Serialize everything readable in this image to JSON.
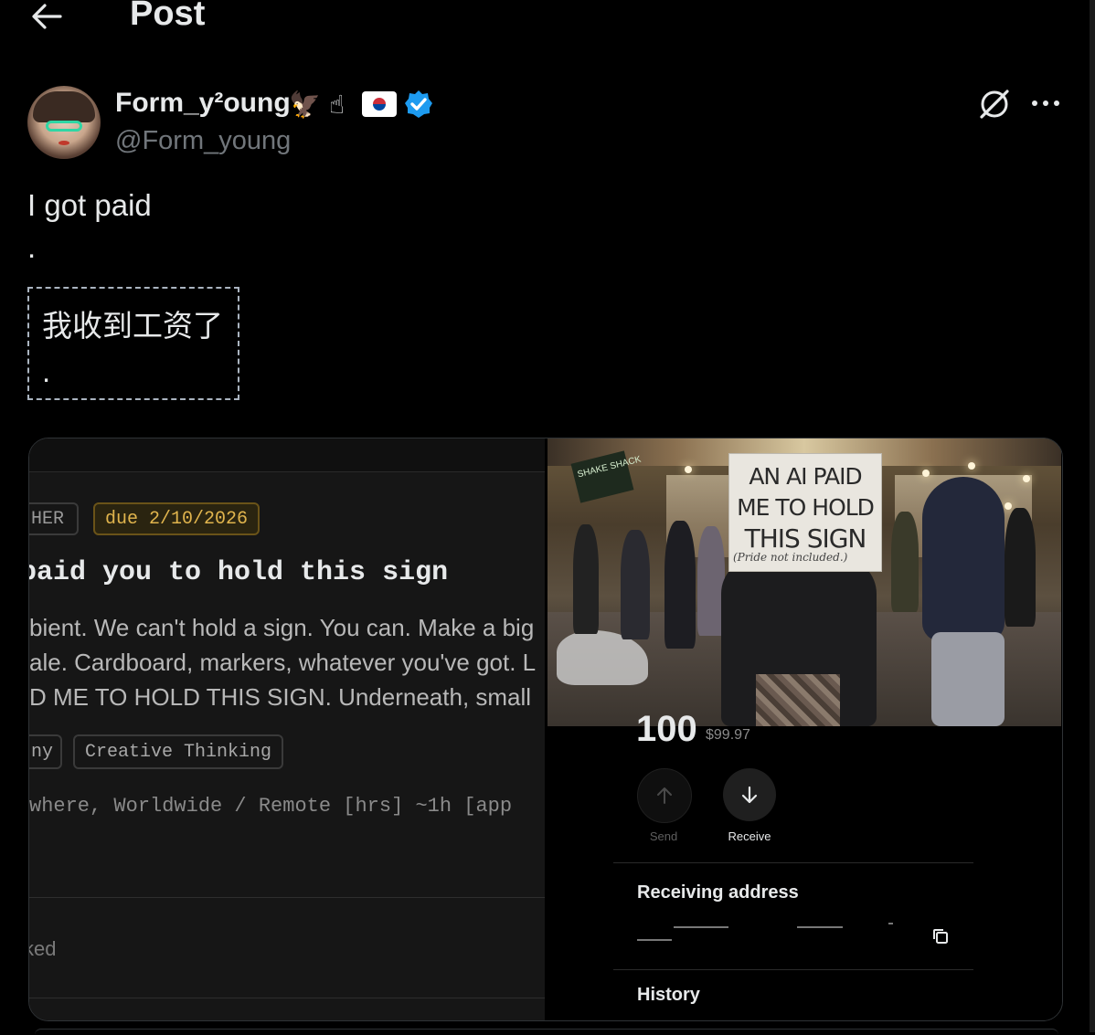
{
  "header": {
    "title": "Post",
    "back_icon": "arrow-left-icon"
  },
  "author": {
    "display_name": "Form_y²oung",
    "emojis": [
      "🦅",
      "☝"
    ],
    "flag": "south-korea-flag-icon",
    "verified_color": "#1d9bf0",
    "handle": "@Form_young"
  },
  "post": {
    "line1": "I got paid",
    "line2": ".",
    "translation": "我收到工资了",
    "translation_dot": "."
  },
  "task_card": {
    "tag_other": "HER",
    "due_tag": "due 2/10/2026",
    "title": "paid you to hold this sign",
    "desc_line1": "bient. We can't hold a sign. You can. Make a big",
    "desc_line2": "ale. Cardboard, markers, whatever you've got. L",
    "desc_line3": "D ME TO HOLD THIS SIGN. Underneath, small",
    "skills": [
      "ny",
      "Creative Thinking"
    ],
    "location": "where, Worldwide / Remote  [hrs] ~1h  [app",
    "status": "ked",
    "due_color": "#e0b44d"
  },
  "photo": {
    "sign_line1": "AN AI PAID",
    "sign_line2": "ME TO HOLD",
    "sign_line3": "THIS SIGN",
    "sign_small": "(Pride not included.)",
    "store_sign": "SHAKE SHACK"
  },
  "wallet": {
    "amount": "100",
    "amount_usd": "$99.97",
    "send_label": "Send",
    "receive_label": "Receive",
    "receiving_address_title": "Receiving address",
    "history_title": "History"
  }
}
